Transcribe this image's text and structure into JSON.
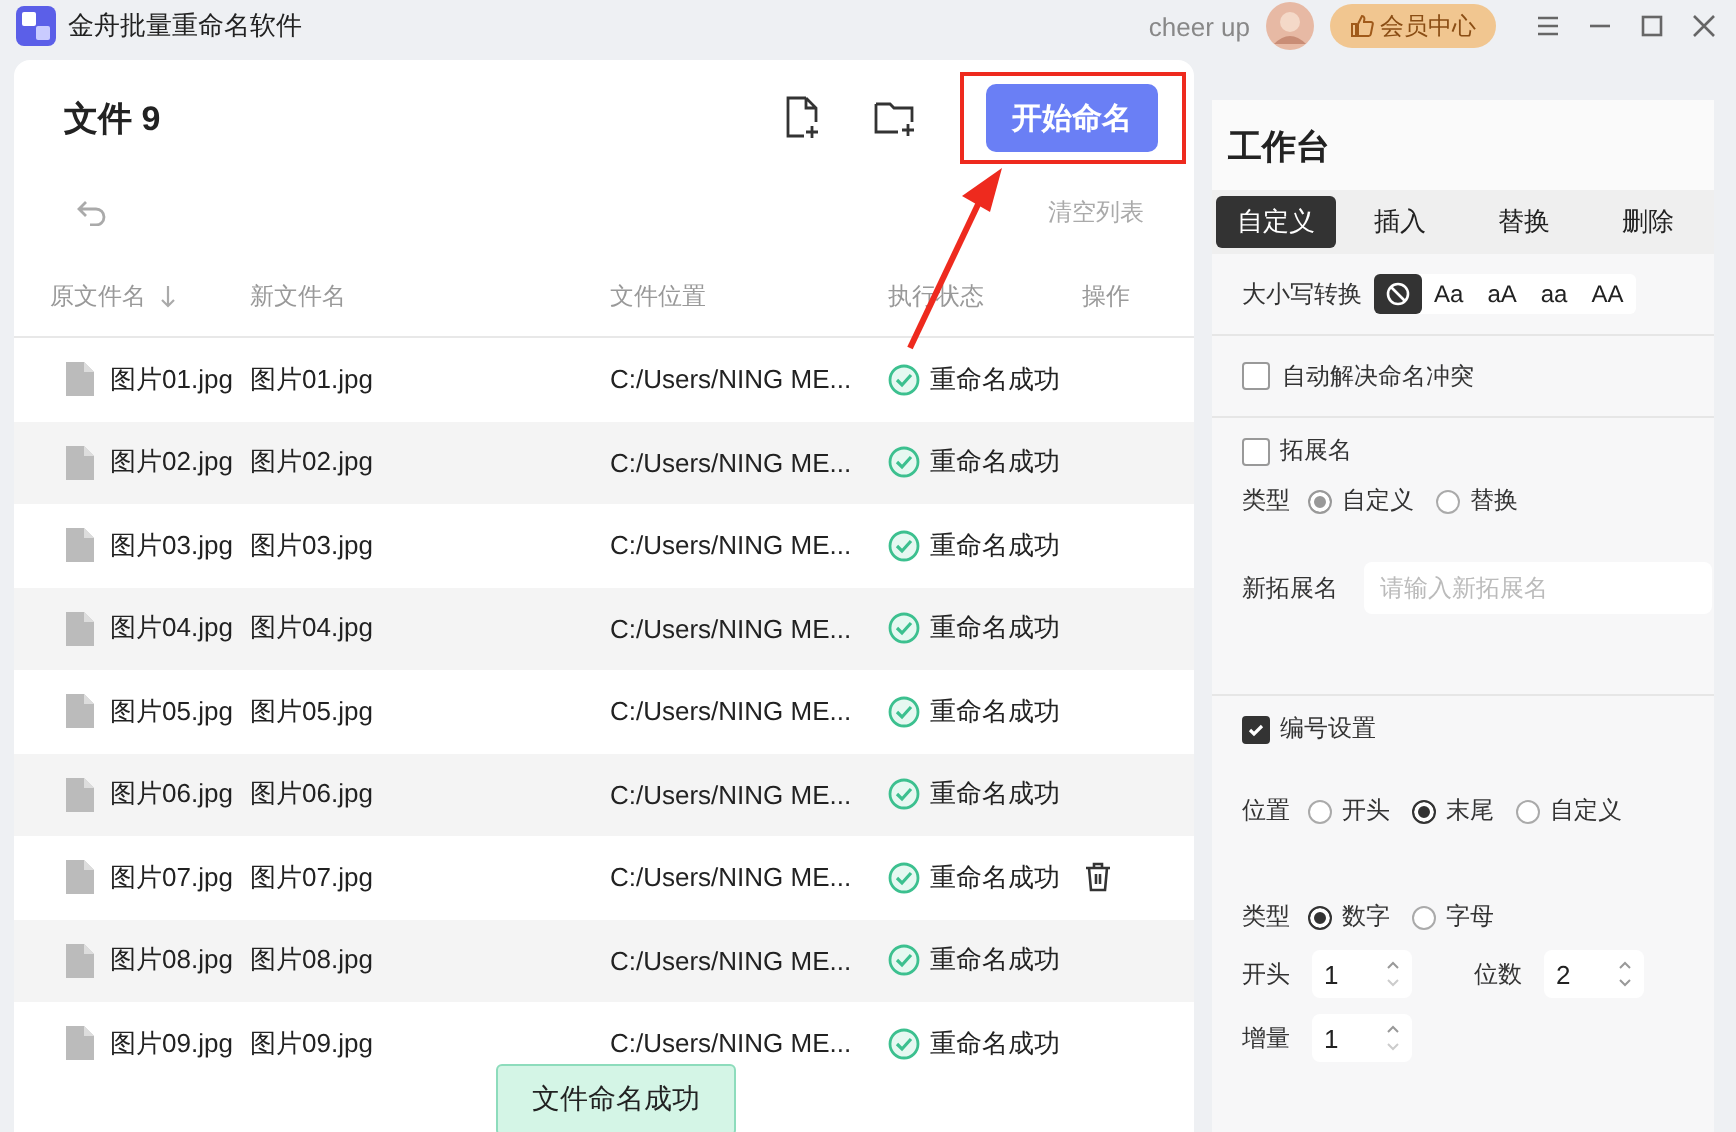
{
  "app": {
    "title": "金舟批量重命名软件",
    "user": "cheer up",
    "vip_button": "会员中心"
  },
  "file_panel": {
    "title": "文件 9",
    "start_button": "开始命名",
    "clear_button": "清空列表",
    "columns": [
      {
        "label": "原文件名",
        "sorted": true
      },
      {
        "label": "新文件名",
        "sorted": false
      },
      {
        "label": "文件位置",
        "sorted": false
      },
      {
        "label": "执行状态",
        "sorted": false
      },
      {
        "label": "操作",
        "sorted": false
      }
    ],
    "rows": [
      {
        "original": "图片01.jpg",
        "new": "图片01.jpg",
        "location": "C:/Users/NING ME...",
        "status": "重命名成功",
        "hovered": false
      },
      {
        "original": "图片02.jpg",
        "new": "图片02.jpg",
        "location": "C:/Users/NING ME...",
        "status": "重命名成功",
        "hovered": false
      },
      {
        "original": "图片03.jpg",
        "new": "图片03.jpg",
        "location": "C:/Users/NING ME...",
        "status": "重命名成功",
        "hovered": false
      },
      {
        "original": "图片04.jpg",
        "new": "图片04.jpg",
        "location": "C:/Users/NING ME...",
        "status": "重命名成功",
        "hovered": false
      },
      {
        "original": "图片05.jpg",
        "new": "图片05.jpg",
        "location": "C:/Users/NING ME...",
        "status": "重命名成功",
        "hovered": false
      },
      {
        "original": "图片06.jpg",
        "new": "图片06.jpg",
        "location": "C:/Users/NING ME...",
        "status": "重命名成功",
        "hovered": false
      },
      {
        "original": "图片07.jpg",
        "new": "图片07.jpg",
        "location": "C:/Users/NING ME...",
        "status": "重命名成功",
        "hovered": true
      },
      {
        "original": "图片08.jpg",
        "new": "图片08.jpg",
        "location": "C:/Users/NING ME...",
        "status": "重命名成功",
        "hovered": false
      },
      {
        "original": "图片09.jpg",
        "new": "图片09.jpg",
        "location": "C:/Users/NING ME...",
        "status": "重命名成功",
        "hovered": false
      }
    ],
    "toast": "文件命名成功"
  },
  "workbench": {
    "title": "工作台",
    "tabs": [
      {
        "label": "自定义",
        "selected": true
      },
      {
        "label": "插入",
        "selected": false
      },
      {
        "label": "替换",
        "selected": false
      },
      {
        "label": "删除",
        "selected": false
      }
    ],
    "case_label": "大小写转换",
    "case_options": [
      {
        "kind": "icon",
        "selected": true
      },
      {
        "kind": "text",
        "label": "Aa",
        "selected": false
      },
      {
        "kind": "text",
        "label": "aA",
        "selected": false
      },
      {
        "kind": "text",
        "label": "aa",
        "selected": false
      },
      {
        "kind": "text",
        "label": "AA",
        "selected": false
      }
    ],
    "auto_resolve": {
      "label": "自动解决命名冲突",
      "checked": false
    },
    "extension": {
      "label": "拓展名",
      "checked": false,
      "type_label": "类型",
      "types": [
        {
          "label": "自定义",
          "selected": true
        },
        {
          "label": "替换",
          "selected": false
        }
      ],
      "name_label": "新拓展名",
      "placeholder": "请输入新拓展名"
    },
    "numbering": {
      "label": "编号设置",
      "checked": true,
      "position_label": "位置",
      "positions": [
        {
          "label": "开头",
          "selected": false
        },
        {
          "label": "末尾",
          "selected": true
        },
        {
          "label": "自定义",
          "selected": false
        }
      ],
      "type_label": "类型",
      "types": [
        {
          "label": "数字",
          "selected": true
        },
        {
          "label": "字母",
          "selected": false
        }
      ],
      "start_label": "开头",
      "start": "1",
      "digits_label": "位数",
      "digits": "2",
      "step_label": "增量",
      "step": "1"
    }
  }
}
